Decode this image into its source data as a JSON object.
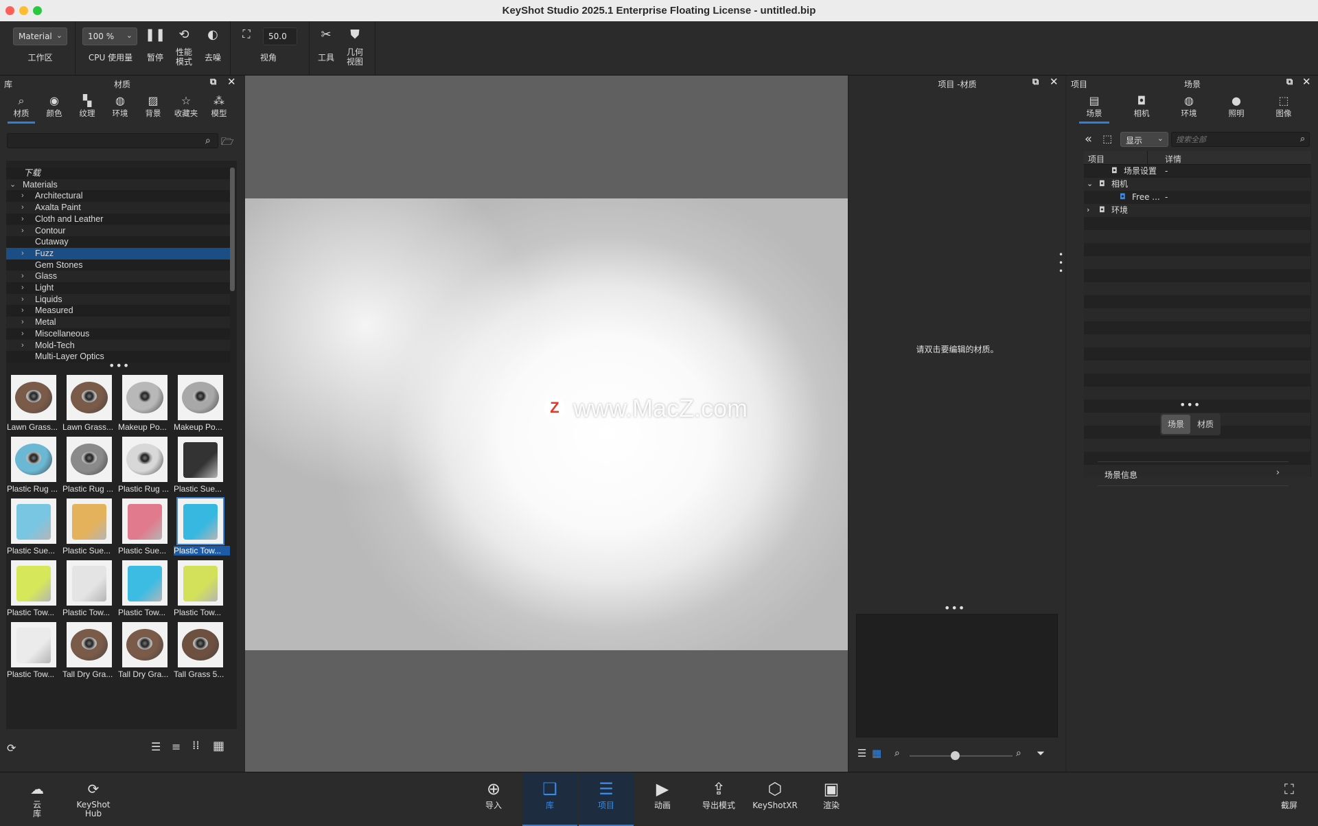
{
  "window": {
    "title": "KeyShot Studio 2025.1 Enterprise Floating License  - untitled.bip"
  },
  "toolbar": {
    "workspace_select": "Material",
    "workspace_label": "工作区",
    "cpu_select": "100 %",
    "cpu_label": "CPU 使用量",
    "pause_label": "暂停",
    "perf_label": "性能\n模式",
    "denoise_label": "去噪",
    "fov_value": "50.0",
    "fov_label": "视角",
    "tools_label": "工具",
    "geometry_label": "几何\n视图"
  },
  "library": {
    "header_left": "库",
    "header_title": "材质",
    "tabs": [
      {
        "label": "材质",
        "icon": "search-icon"
      },
      {
        "label": "颜色",
        "icon": "palette-icon"
      },
      {
        "label": "纹理",
        "icon": "checker-icon"
      },
      {
        "label": "环境",
        "icon": "globe-icon"
      },
      {
        "label": "背景",
        "icon": "image-icon"
      },
      {
        "label": "收藏夹",
        "icon": "star-icon"
      },
      {
        "label": "模型",
        "icon": "models-icon"
      }
    ],
    "search_placeholder": "",
    "tree_root_download": "下载",
    "tree_root_materials": "Materials",
    "tree_items": [
      {
        "label": "Architectural",
        "expandable": true
      },
      {
        "label": "Axalta Paint",
        "expandable": true
      },
      {
        "label": "Cloth and Leather",
        "expandable": true
      },
      {
        "label": "Contour",
        "expandable": true
      },
      {
        "label": "Cutaway",
        "expandable": false
      },
      {
        "label": "Fuzz",
        "expandable": true,
        "selected": true
      },
      {
        "label": "Gem Stones",
        "expandable": false
      },
      {
        "label": "Glass",
        "expandable": true
      },
      {
        "label": "Light",
        "expandable": true
      },
      {
        "label": "Liquids",
        "expandable": true
      },
      {
        "label": "Measured",
        "expandable": true
      },
      {
        "label": "Metal",
        "expandable": true
      },
      {
        "label": "Miscellaneous",
        "expandable": true
      },
      {
        "label": "Mold-Tech",
        "expandable": true
      },
      {
        "label": "Multi-Layer Optics",
        "expandable": false
      }
    ],
    "thumbnails": [
      {
        "label": "Lawn Grass...",
        "kind": "disc",
        "color": "#7a5a48"
      },
      {
        "label": "Lawn Grass...",
        "kind": "disc",
        "color": "#7a5a48"
      },
      {
        "label": "Makeup Po...",
        "kind": "disc",
        "color": "#b8b8b8"
      },
      {
        "label": "Makeup Po...",
        "kind": "disc",
        "color": "#a8a8a8"
      },
      {
        "label": "Plastic Rug ...",
        "kind": "disc",
        "color": "#6ab8d4"
      },
      {
        "label": "Plastic Rug ...",
        "kind": "disc",
        "color": "#8a8a8a"
      },
      {
        "label": "Plastic Rug ...",
        "kind": "disc",
        "color": "#d8d8d8"
      },
      {
        "label": "Plastic Sue...",
        "kind": "towel",
        "color": "#333333"
      },
      {
        "label": "Plastic Sue...",
        "kind": "towel",
        "color": "#79c6e2"
      },
      {
        "label": "Plastic Sue...",
        "kind": "towel",
        "color": "#e4b25a"
      },
      {
        "label": "Plastic Sue...",
        "kind": "towel",
        "color": "#e07a8c"
      },
      {
        "label": "Plastic Tow...",
        "kind": "towel",
        "color": "#36b8e0",
        "selected": true
      },
      {
        "label": "Plastic Tow...",
        "kind": "towel",
        "color": "#d6e85a"
      },
      {
        "label": "Plastic Tow...",
        "kind": "towel",
        "color": "#e4e4e4"
      },
      {
        "label": "Plastic Tow...",
        "kind": "towel",
        "color": "#3cbce2"
      },
      {
        "label": "Plastic Tow...",
        "kind": "towel",
        "color": "#d2e05a"
      },
      {
        "label": "Plastic Tow...",
        "kind": "towel",
        "color": "#ebebeb"
      },
      {
        "label": "Tall Dry Gra...",
        "kind": "disc",
        "color": "#7a5a48"
      },
      {
        "label": "Tall Dry Gra...",
        "kind": "disc",
        "color": "#7a5a48"
      },
      {
        "label": "Tall Grass 5...",
        "kind": "disc",
        "color": "#6e5040"
      }
    ]
  },
  "viewport": {
    "watermark": "www.MacZ.com",
    "watermark_logo": "Z"
  },
  "project_material": {
    "header_title": "项目 -材质",
    "hint": "请双击要编辑的材质。"
  },
  "scene": {
    "header_left": "项目",
    "header_title": "场景",
    "tabs": [
      {
        "label": "场景",
        "icon": "list-icon"
      },
      {
        "label": "相机",
        "icon": "camera-icon"
      },
      {
        "label": "环境",
        "icon": "globe-icon"
      },
      {
        "label": "照明",
        "icon": "bulb-icon"
      },
      {
        "label": "图像",
        "icon": "crop-icon"
      }
    ],
    "display_select": "显示",
    "search_placeholder": "搜索全部",
    "col_item": "项目",
    "col_detail": "详情",
    "rows": [
      {
        "label": "场景设置",
        "detail": "-",
        "indent": 1
      },
      {
        "label": "相机",
        "detail": "",
        "indent": 0,
        "expanded": true
      },
      {
        "label": "Free ...",
        "detail": "-",
        "indent": 2,
        "active": true
      },
      {
        "label": "环境",
        "detail": "",
        "indent": 0,
        "expanded": false
      }
    ],
    "seg_scene": "场景",
    "seg_material": "材质",
    "scene_info": "场景信息"
  },
  "bottombar": {
    "cloud_label": "云\n库",
    "hub_label": "KeyShot\nHub",
    "items": [
      {
        "label": "导入",
        "icon": "import-icon"
      },
      {
        "label": "库",
        "icon": "book-icon",
        "active": true
      },
      {
        "label": "项目",
        "icon": "project-icon",
        "active": true
      },
      {
        "label": "动画",
        "icon": "play-icon"
      },
      {
        "label": "导出模式",
        "icon": "share-icon"
      },
      {
        "label": "KeyShotXR",
        "icon": "cube-icon"
      },
      {
        "label": "渲染",
        "icon": "render-icon"
      }
    ],
    "screenshot_label": "截屏"
  },
  "colors": {
    "accent": "#2f7fe0",
    "selection": "#1c4e86",
    "panel": "#2b2b2b"
  }
}
